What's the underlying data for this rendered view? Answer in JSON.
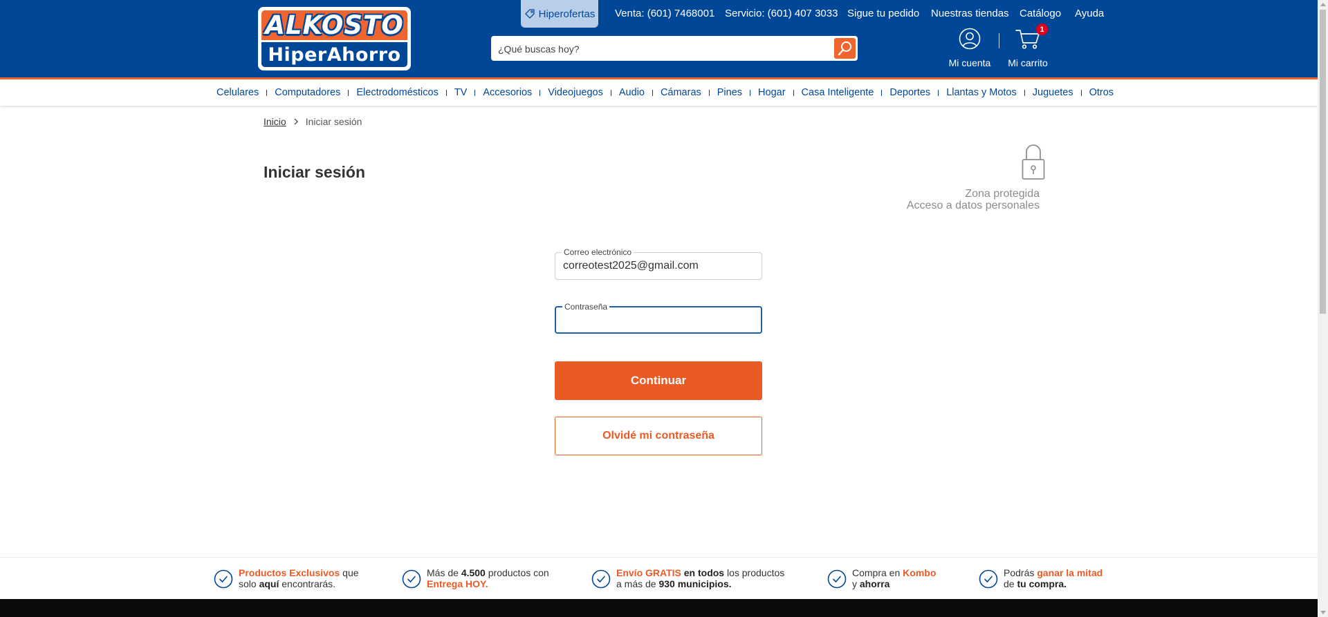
{
  "header": {
    "logo_top": "ALKOSTO",
    "logo_bottom": "HiperAhorro",
    "hiperofertas": "Hiperofertas",
    "toplinks": [
      "Venta: (601) 7468001",
      "Servicio: (601) 407 3033",
      "Sigue tu pedido",
      "Nuestras tiendas",
      "Catálogo",
      "Ayuda"
    ],
    "search_placeholder": "¿Qué buscas hoy?",
    "account_label": "Mi cuenta",
    "cart_label": "Mi carrito",
    "cart_count": "1"
  },
  "categories": [
    "Celulares",
    "Computadores",
    "Electrodomésticos",
    "TV",
    "Accesorios",
    "Videojuegos",
    "Audio",
    "Cámaras",
    "Pines",
    "Hogar",
    "Casa Inteligente",
    "Deportes",
    "Llantas y Motos",
    "Juguetes",
    "Otros"
  ],
  "breadcrumb": {
    "home": "Inicio",
    "current": "Iniciar sesión"
  },
  "page": {
    "title": "Iniciar sesión",
    "protected_line1": "Zona protegida",
    "protected_line2": "Acceso a datos personales"
  },
  "form": {
    "email_label": "Correo electrónico",
    "email_value": "correotest2025@gmail.com",
    "password_label": "Contraseña",
    "password_value": "",
    "continue_label": "Continuar",
    "forgot_label": "Olvidé mi contraseña"
  },
  "benefits": [
    {
      "parts": [
        {
          "t": "Productos Exclusivos",
          "s": "or"
        },
        {
          "t": " que",
          "s": ""
        },
        {
          "br": true
        },
        {
          "t": "solo ",
          "s": ""
        },
        {
          "t": "aquí",
          "s": "bd"
        },
        {
          "t": " encontrarás.",
          "s": ""
        }
      ]
    },
    {
      "parts": [
        {
          "t": "Más de ",
          "s": ""
        },
        {
          "t": "4.500",
          "s": "bd"
        },
        {
          "t": " productos con",
          "s": ""
        },
        {
          "br": true
        },
        {
          "t": "Entrega HOY.",
          "s": "or"
        }
      ]
    },
    {
      "parts": [
        {
          "t": "Envío GRATIS",
          "s": "or"
        },
        {
          "t": " ",
          "s": ""
        },
        {
          "t": "en todos",
          "s": "bd"
        },
        {
          "t": " los productos",
          "s": ""
        },
        {
          "br": true
        },
        {
          "t": "a más de ",
          "s": ""
        },
        {
          "t": "930 municipios.",
          "s": "bd"
        }
      ]
    },
    {
      "parts": [
        {
          "t": "Compra en ",
          "s": ""
        },
        {
          "t": "Kombo",
          "s": "or"
        },
        {
          "br": true
        },
        {
          "t": "y ",
          "s": ""
        },
        {
          "t": "ahorra",
          "s": "bd"
        }
      ]
    },
    {
      "parts": [
        {
          "t": "Podrás ",
          "s": ""
        },
        {
          "t": "ganar la mitad",
          "s": "or"
        },
        {
          "br": true
        },
        {
          "t": "de ",
          "s": ""
        },
        {
          "t": "tu compra.",
          "s": "bd"
        }
      ]
    }
  ],
  "colors": {
    "brand_blue": "#004797",
    "brand_orange": "#ea5a24",
    "badge_red": "#e3001b"
  },
  "icons": [
    "tag-icon",
    "search-icon",
    "user-icon",
    "cart-icon",
    "lock-icon",
    "check-circle-icon",
    "chevron-right-icon"
  ]
}
